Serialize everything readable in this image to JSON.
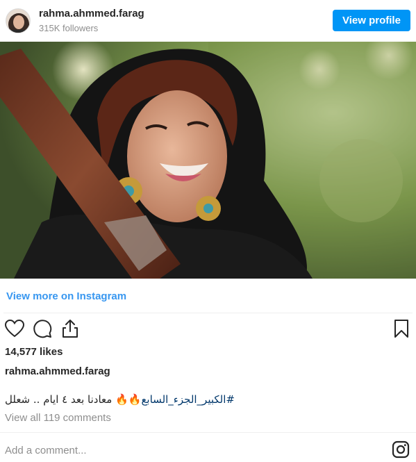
{
  "header": {
    "username": "rahma.ahmmed.farag",
    "followers": "315K followers",
    "view_profile_label": "View profile"
  },
  "post": {
    "view_more_label": "View more on Instagram",
    "likes": "14,577 likes",
    "author": "rahma.ahmmed.farag",
    "caption_tag": "#الكبير_الجزء_السابع",
    "caption_rest": "🔥🔥 معادنا بعد ٤ ايام .. شعلل",
    "view_comments_label": "View all 119 comments"
  },
  "comment": {
    "placeholder": "Add a comment..."
  },
  "icons": {
    "like": "heart-icon",
    "comment": "comment-icon",
    "share": "share-icon",
    "save": "bookmark-icon",
    "instagram": "instagram-icon"
  },
  "colors": {
    "accent": "#0095f6",
    "link": "#3897f0",
    "muted": "#8e8e8e"
  }
}
